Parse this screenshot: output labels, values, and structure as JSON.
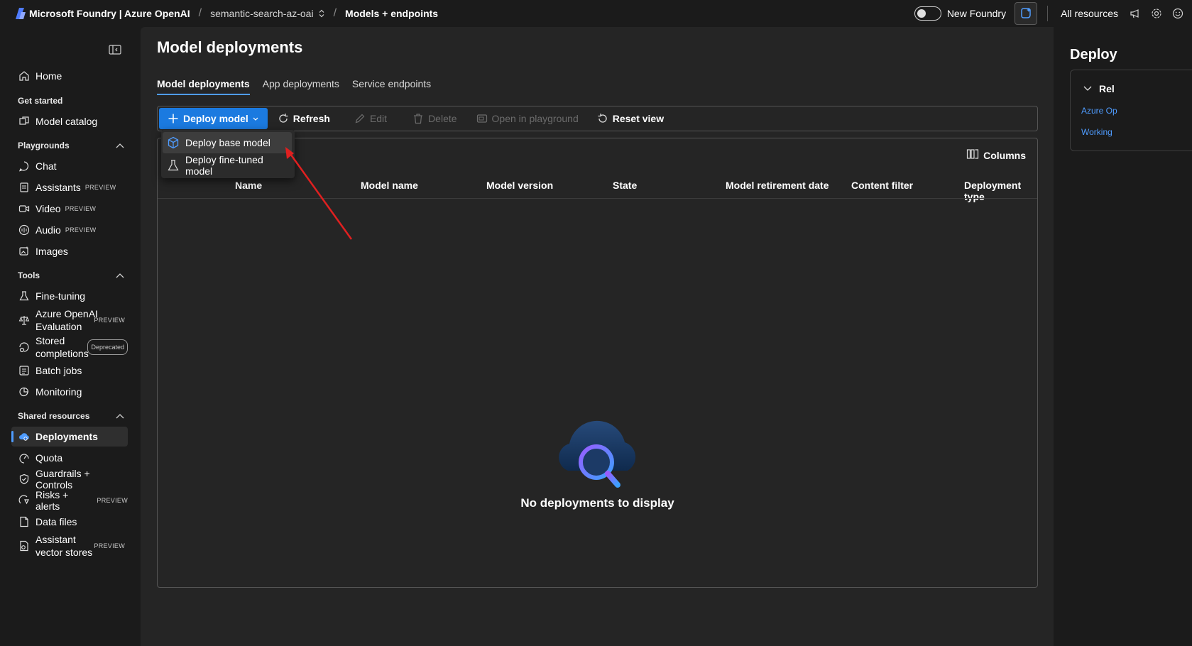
{
  "topbar": {
    "brand": "Microsoft Foundry | Azure OpenAI",
    "project": "semantic-search-az-oai",
    "current_page": "Models + endpoints",
    "new_foundry_label": "New Foundry",
    "all_resources_label": "All resources"
  },
  "sidebar": {
    "home": "Home",
    "get_started": "Get started",
    "model_catalog": "Model catalog",
    "playgrounds": "Playgrounds",
    "chat": "Chat",
    "assistants": "Assistants",
    "video": "Video",
    "audio": "Audio",
    "images": "Images",
    "tools": "Tools",
    "fine_tuning": "Fine-tuning",
    "evaluation_line1": "Azure OpenAI",
    "evaluation_line2": "Evaluation",
    "stored_line1": "Stored",
    "stored_line2": "completions",
    "batch_jobs": "Batch jobs",
    "monitoring": "Monitoring",
    "shared_resources": "Shared resources",
    "deployments": "Deployments",
    "quota": "Quota",
    "guardrails": "Guardrails + Controls",
    "risks": "Risks + alerts",
    "data_files": "Data files",
    "vector_line1": "Assistant",
    "vector_line2": "vector stores",
    "preview_badge": "PREVIEW",
    "deprecated_badge": "Deprecated"
  },
  "main": {
    "title": "Model deployments",
    "tabs": [
      "Model deployments",
      "App deployments",
      "Service endpoints"
    ],
    "toolbar": {
      "deploy_model": "Deploy model",
      "refresh": "Refresh",
      "edit": "Edit",
      "delete": "Delete",
      "open_playground": "Open in playground",
      "reset_view": "Reset view"
    },
    "columns_label": "Columns",
    "headers": [
      "Name",
      "Model name",
      "Model version",
      "State",
      "Model retirement date",
      "Content filter",
      "Deployment type"
    ],
    "empty_text": "No deployments to display"
  },
  "menu": {
    "deploy_base": "Deploy base model",
    "deploy_finetuned": "Deploy fine-tuned model"
  },
  "right_panel": {
    "title": "Deploy",
    "section": "Rel",
    "link1": "Azure Op",
    "link2": "Working"
  },
  "colors": {
    "accent": "#1b7ae0",
    "link": "#4f9cff",
    "annotation_arrow": "#e02020"
  }
}
